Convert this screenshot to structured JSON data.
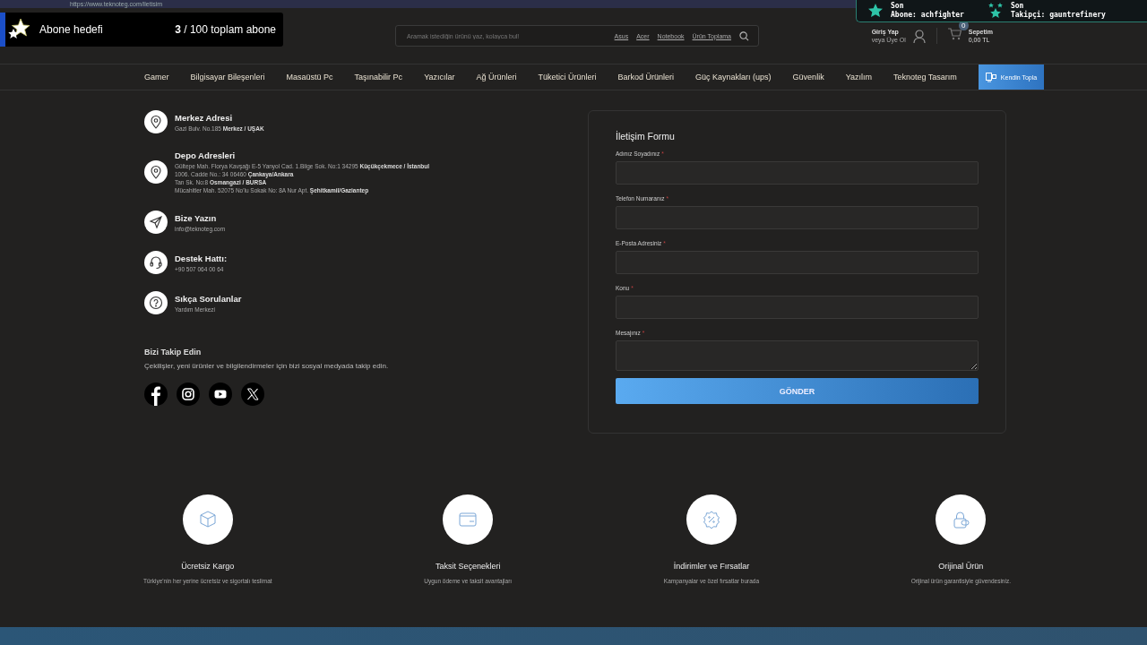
{
  "browser": {
    "url": "https://www.teknoteg.com/iletisim"
  },
  "overlay": {
    "goal": {
      "label": "Abone hedefi",
      "count": "3",
      "total": "/ 100 toplam abone"
    },
    "recent": [
      {
        "kind": "subscriber",
        "line_1": "Son",
        "line_2": "Abone:",
        "name": "achfighter"
      },
      {
        "kind": "follower",
        "line_1": "Son",
        "line_2": "Takipçi:",
        "name": "gauntrefinery"
      }
    ]
  },
  "header": {
    "search": {
      "placeholder": "Aramak istediğin ürünü yaz, kolayca bul!",
      "quick_links": [
        "Asus",
        "Acer",
        "Notebook",
        "Ürün Toplama"
      ]
    },
    "account": {
      "login": "Giriş Yap",
      "register": "veya Üye Ol"
    },
    "cart": {
      "count": "0",
      "label": "Sepetim",
      "total": "0,00 TL"
    }
  },
  "nav": [
    {
      "label": "Gamer",
      "kind": "link"
    },
    {
      "label": "Bilgisayar Bileşenleri",
      "kind": "link"
    },
    {
      "label": "Masaüstü Pc",
      "kind": "link"
    },
    {
      "label": "Taşınabilir Pc",
      "kind": "link"
    },
    {
      "label": "Yazıcılar",
      "kind": "link"
    },
    {
      "label": "Ağ Ürünleri",
      "kind": "link"
    },
    {
      "label": "Tüketici Ürünleri",
      "kind": "link"
    },
    {
      "label": "Barkod Ürünleri",
      "kind": "link"
    },
    {
      "label": "Güç Kaynakları (ups)",
      "kind": "link"
    },
    {
      "label": "Güvenlik",
      "kind": "link"
    },
    {
      "label": "Yazılım",
      "kind": "link"
    },
    {
      "label": "Teknoteg Tasarım",
      "kind": "link"
    },
    {
      "label": "Kendin Topla",
      "kind": "button"
    }
  ],
  "contacts": [
    {
      "kind": "pin",
      "title": "Merkez Adresi",
      "lines": [
        "Gazi Bulv. No.185 **Merkez / UŞAK**"
      ]
    },
    {
      "kind": "pin",
      "title": "Depo Adresleri",
      "lines": [
        "Gültepe Mah. Florya Kavşağı E-5 Yanyol Cad. 1.Bilge Sok. No:1 34295 **Küçükçekmece / İstanbul**",
        "1006. Cadde No.: 34 06460 **Çankaya/Ankara**",
        "Tan Sk. No:8 **Osmangazi / BURSA**",
        "Mücahitler Mah. 52075 No'lu Sokak No: 8A Nur Apt. **Şehitkamil/Gaziantep**"
      ]
    },
    {
      "kind": "send",
      "title": "Bize Yazın",
      "lines": [
        "info@teknoteg.com"
      ]
    },
    {
      "kind": "headset",
      "title": "Destek Hattı:",
      "lines": [
        "+90 507 064 00 64"
      ]
    },
    {
      "kind": "question",
      "title": "Sıkça Sorulanlar",
      "lines": [
        "Yardım Merkezi"
      ]
    }
  ],
  "social": {
    "title": "Bizi Takip Edin",
    "text": "Çekilişler, yeni ürünler ve bilgilendirmeler için bizi sosyal medyada takip edin.",
    "links": [
      {
        "kind": "facebook"
      },
      {
        "kind": "instagram"
      },
      {
        "kind": "youtube"
      },
      {
        "kind": "x"
      }
    ]
  },
  "form": {
    "title": "İletişim Formu",
    "required_mark": "*",
    "fields": [
      {
        "label": "Adınız Soyadınız",
        "required": true,
        "kind": "input"
      },
      {
        "label": "Telefon Numaranız",
        "required": true,
        "kind": "input"
      },
      {
        "label": "E-Posta Adresiniz",
        "required": true,
        "kind": "input"
      },
      {
        "label": "Konu",
        "required": true,
        "kind": "input"
      },
      {
        "label": "Mesajınız",
        "required": true,
        "kind": "textarea"
      }
    ],
    "submit": "GÖNDER"
  },
  "features": [
    {
      "kind": "box",
      "title": "Ücretsiz Kargo",
      "text": "Türkiye'nin her yerine ücretsiz ve sigortalı teslimat"
    },
    {
      "kind": "wallet",
      "title": "Taksit Seçenekleri",
      "text": "Uygun ödeme ve taksit avantajları"
    },
    {
      "kind": "discount",
      "title": "İndirimler ve Fırsatlar",
      "text": "Kampanyalar ve özel fırsatlar burada"
    },
    {
      "kind": "lock",
      "title": "Orijinal Ürün",
      "text": "Orijinal ürün garantisiyle güvendesiniz."
    }
  ]
}
